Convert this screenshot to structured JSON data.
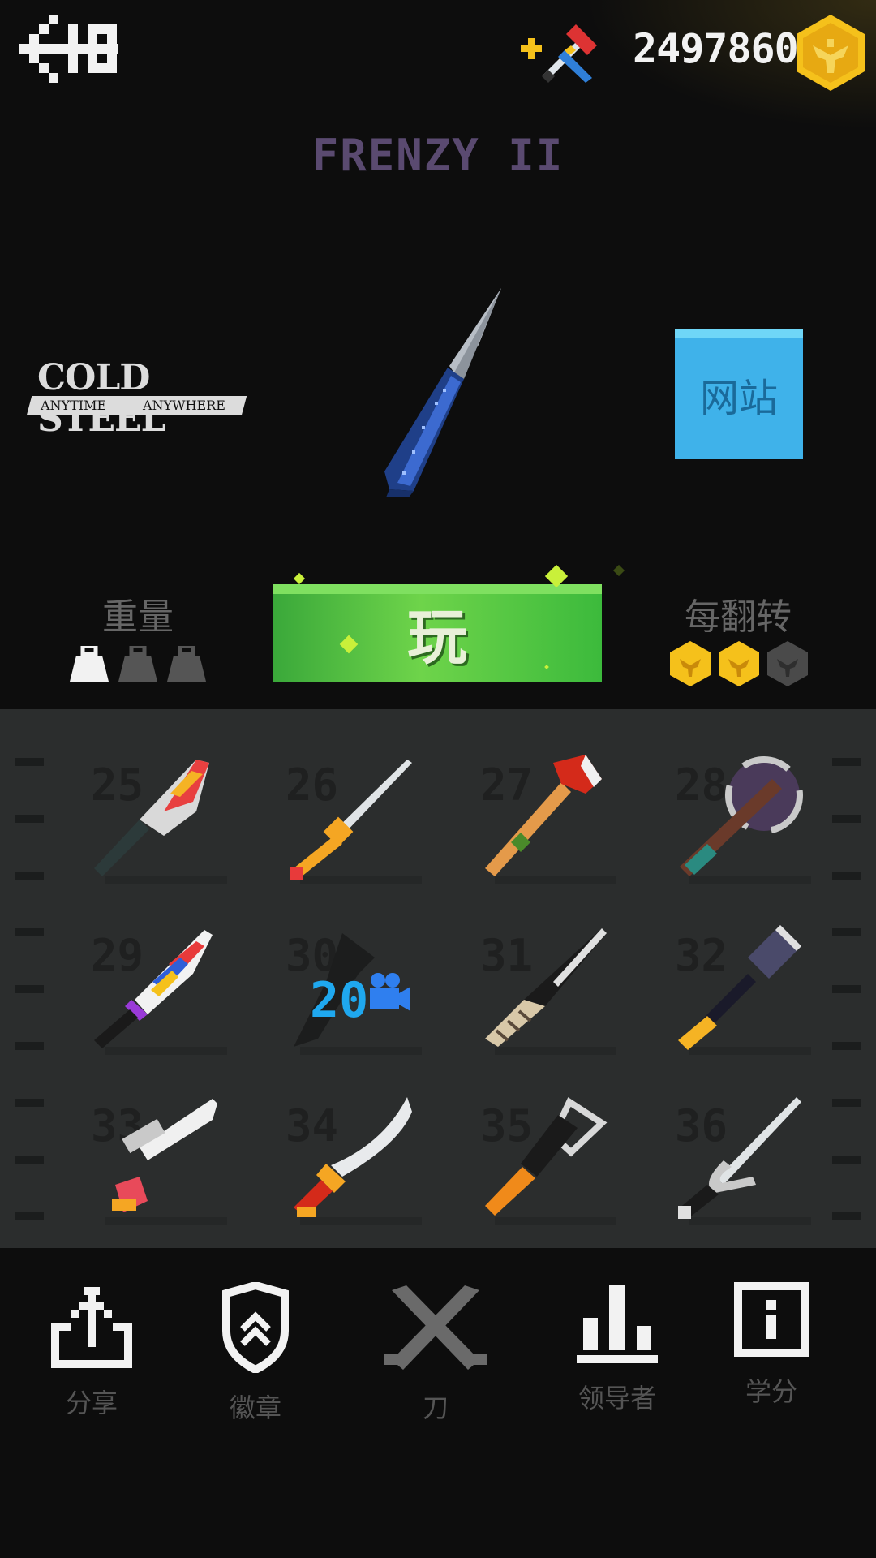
{
  "header": {
    "coins": "2497860",
    "title": "FRENZY II"
  },
  "brand": {
    "name": "COLD STEEL",
    "tagline_left": "ANYTIME",
    "tagline_right": "ANYWHERE"
  },
  "website_button": "网站",
  "stats": {
    "weight_label": "重量",
    "weight_level": 1,
    "weight_max": 3,
    "flip_label": "每翻转",
    "flip_reward": 2,
    "flip_max": 3
  },
  "play_button": "玩",
  "knife_grid": {
    "items": [
      {
        "number": "25",
        "icon": "cleaver-knife-icon"
      },
      {
        "number": "26",
        "icon": "golden-sword-icon"
      },
      {
        "number": "27",
        "icon": "fire-axe-icon"
      },
      {
        "number": "28",
        "icon": "battle-axe-icon"
      },
      {
        "number": "29",
        "icon": "colorful-combat-knife-icon"
      },
      {
        "number": "30",
        "icon": "locked-video-knife-icon",
        "video_cost": "20"
      },
      {
        "number": "31",
        "icon": "rope-handle-knife-icon"
      },
      {
        "number": "32",
        "icon": "war-hammer-icon"
      },
      {
        "number": "33",
        "icon": "scope-blade-icon"
      },
      {
        "number": "34",
        "icon": "scimitar-icon"
      },
      {
        "number": "35",
        "icon": "orange-machete-icon"
      },
      {
        "number": "36",
        "icon": "karambit-icon"
      }
    ]
  },
  "nav": [
    {
      "label": "分享",
      "icon": "share-icon"
    },
    {
      "label": "徽章",
      "icon": "badge-shield-icon"
    },
    {
      "label": "刀",
      "icon": "crossed-knives-icon"
    },
    {
      "label": "领导者",
      "icon": "leaderboard-icon"
    },
    {
      "label": "学分",
      "icon": "info-icon"
    }
  ],
  "colors": {
    "coin": "#f5c11b",
    "play_green": "#4cc43c",
    "website_blue": "#3fb2ea",
    "title_purple": "#5a4a70",
    "video_blue": "#1fa8ef"
  }
}
